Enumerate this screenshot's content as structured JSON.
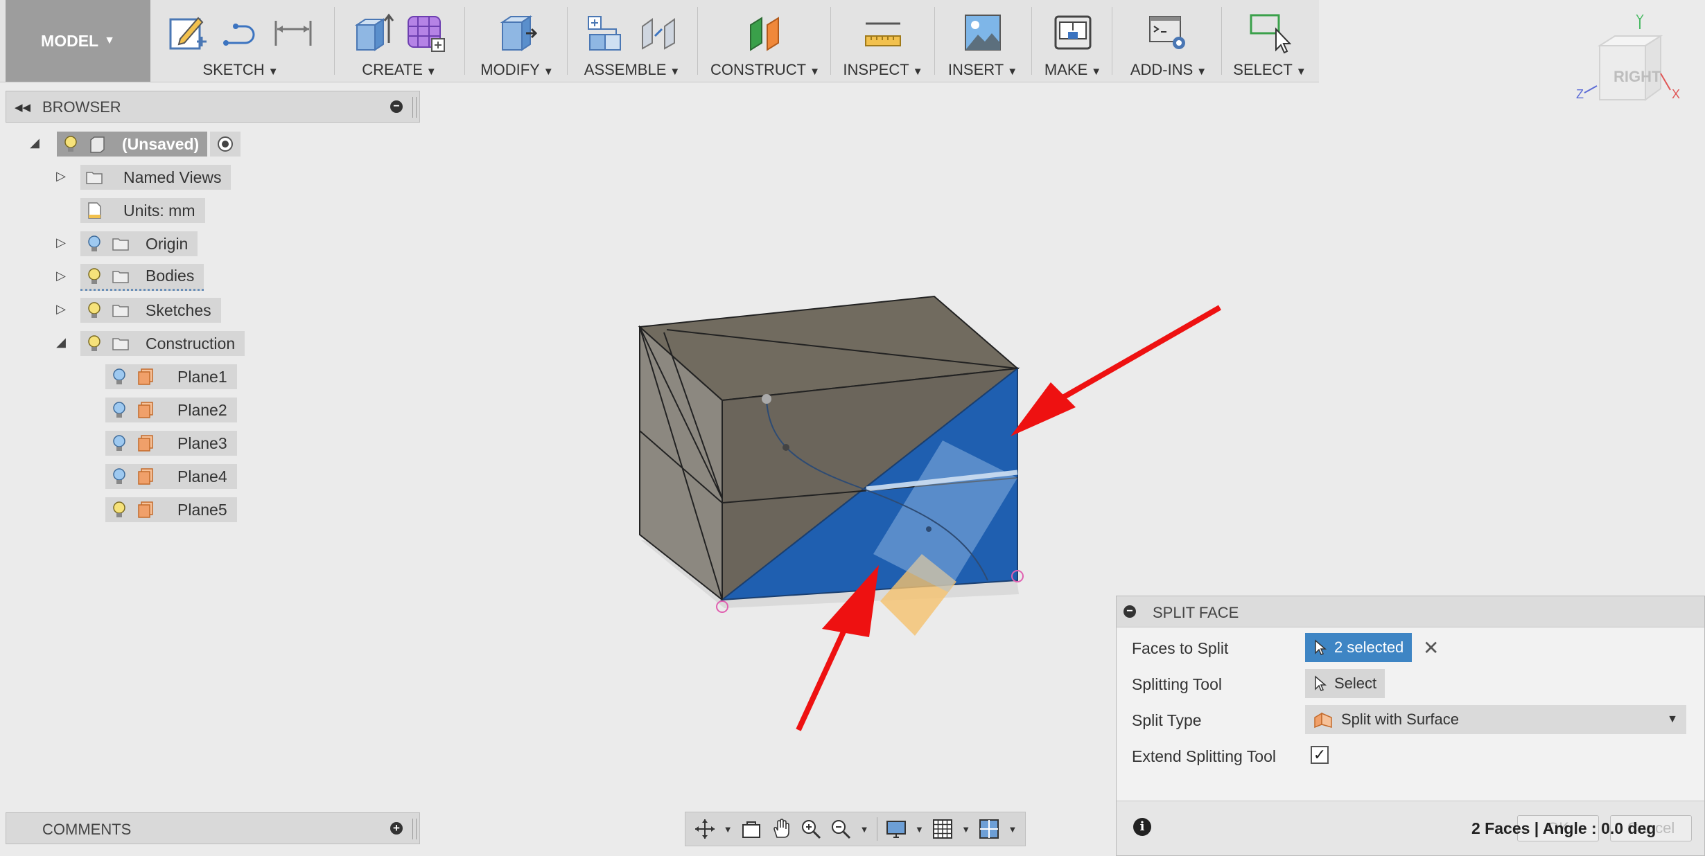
{
  "toolbar": {
    "workspace": "MODEL",
    "groups": [
      {
        "label": "SKETCH"
      },
      {
        "label": "CREATE"
      },
      {
        "label": "MODIFY"
      },
      {
        "label": "ASSEMBLE"
      },
      {
        "label": "CONSTRUCT"
      },
      {
        "label": "INSPECT"
      },
      {
        "label": "INSERT"
      },
      {
        "label": "MAKE"
      },
      {
        "label": "ADD-INS"
      },
      {
        "label": "SELECT"
      }
    ]
  },
  "viewcube": {
    "face": "RIGHT",
    "axis_x": "X",
    "axis_y": "Y",
    "axis_z": "Z"
  },
  "browser": {
    "title": "BROWSER",
    "root": "(Unsaved)",
    "items": [
      {
        "label": "Named Views"
      },
      {
        "label": "Units: mm"
      },
      {
        "label": "Origin"
      },
      {
        "label": "Bodies"
      },
      {
        "label": "Sketches"
      },
      {
        "label": "Construction"
      }
    ],
    "planes": [
      "Plane1",
      "Plane2",
      "Plane3",
      "Plane4",
      "Plane5"
    ]
  },
  "comments": {
    "title": "COMMENTS"
  },
  "dialog": {
    "title": "SPLIT FACE",
    "faces_label": "Faces to Split",
    "faces_value": "2 selected",
    "tool_label": "Splitting Tool",
    "tool_value": "Select",
    "type_label": "Split Type",
    "type_value": "Split with Surface",
    "extend_label": "Extend Splitting Tool",
    "extend_checked": "✓",
    "status": "2 Faces | Angle : 0.0 deg",
    "ok": "OK",
    "cancel": "Cancel"
  },
  "colors": {
    "selection_blue": "#1f5fb0",
    "annotation_red": "#ee1111",
    "active_button": "#3e85c4"
  }
}
